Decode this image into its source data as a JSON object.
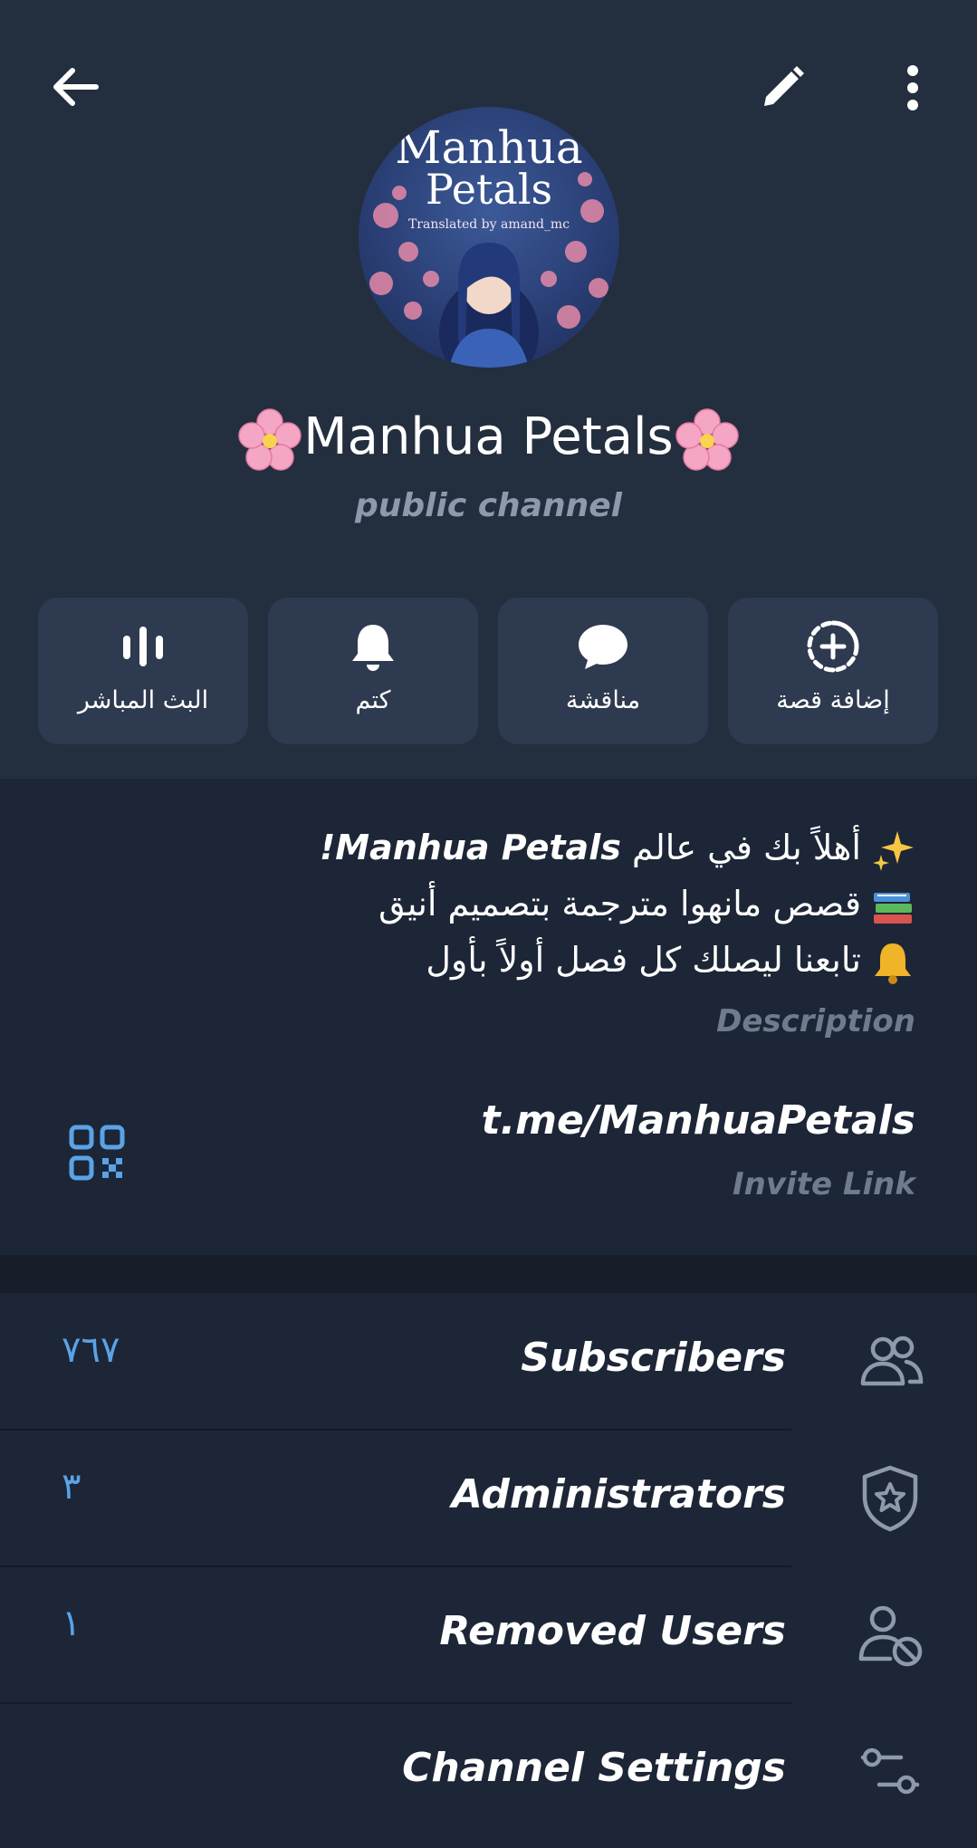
{
  "header": {
    "back_icon": "arrow-left-icon",
    "edit_icon": "pencil-icon",
    "more_icon": "more-vertical-icon"
  },
  "avatar": {
    "title_line1": "Manhua",
    "title_line2": "Petals",
    "subtitle": "Translated by amand_mc"
  },
  "channel": {
    "name": "Manhua Petals",
    "type": "public channel"
  },
  "actions": [
    {
      "label": "البث المباشر",
      "icon": "live-stream-icon"
    },
    {
      "label": "كتم",
      "icon": "bell-icon"
    },
    {
      "label": "مناقشة",
      "icon": "chat-bubble-icon"
    },
    {
      "label": "إضافة قصة",
      "icon": "add-story-icon"
    }
  ],
  "description": {
    "line1_prefix": "أهلاً بك في عالم ",
    "line1_bold": "Manhua Petals!",
    "line2": "قصص مانهوا مترجمة بتصميم أنيق",
    "line3": "تابعنا ليصلك كل فصل أولاً بأول",
    "label": "Description"
  },
  "invite": {
    "link": "t.me/ManhuaPetals",
    "label": "Invite Link",
    "qr_icon": "qr-code-icon"
  },
  "rows": [
    {
      "label": "Subscribers",
      "count": "٧٦٧",
      "icon": "people-icon"
    },
    {
      "label": "Administrators",
      "count": "٣",
      "icon": "shield-star-icon"
    },
    {
      "label": "Removed Users",
      "count": "١",
      "icon": "user-blocked-icon"
    },
    {
      "label": "Channel Settings",
      "count": "",
      "icon": "settings-sliders-icon"
    }
  ],
  "colors": {
    "header_bg": "#232e3f",
    "button_bg": "#2e3a4f",
    "accent": "#5aa3e6",
    "muted": "#8e9aac"
  }
}
